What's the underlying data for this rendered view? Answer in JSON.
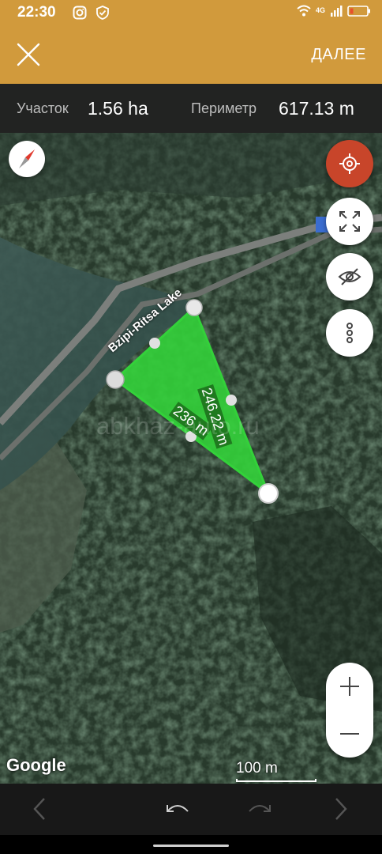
{
  "status_bar": {
    "time": "22:30",
    "network": "4G"
  },
  "app_bar": {
    "close_icon": "close-icon",
    "next_label": "ДАЛЕЕ",
    "background_color": "#d19a3c"
  },
  "measurements": {
    "area_label": "Участок",
    "area_value": "1.56 ha",
    "perimeter_label": "Периметр",
    "perimeter_value": "617.13 m"
  },
  "map": {
    "place_label": "Bzipi-Ritsa Lake",
    "segment_labels": {
      "right_edge": "246.22 m",
      "bottom_edge": "236 m"
    },
    "polygon_color": "#33d13a",
    "watermark": "abkhaz-auto.ru",
    "attribution": "Google",
    "scale_label": "100 m"
  },
  "controls": {
    "compass": "compass-icon",
    "locate": "target-icon",
    "fullscreen": "expand-icon",
    "visibility": "eye-off-icon",
    "more": "more-vertical-icon",
    "zoom_in": "plus-icon",
    "zoom_out": "minus-icon",
    "locate_color": "#c8452a"
  },
  "bottom_bar": {
    "back": "chevron-left-icon",
    "undo": "undo-icon",
    "redo": "redo-icon",
    "forward": "chevron-right-icon"
  }
}
